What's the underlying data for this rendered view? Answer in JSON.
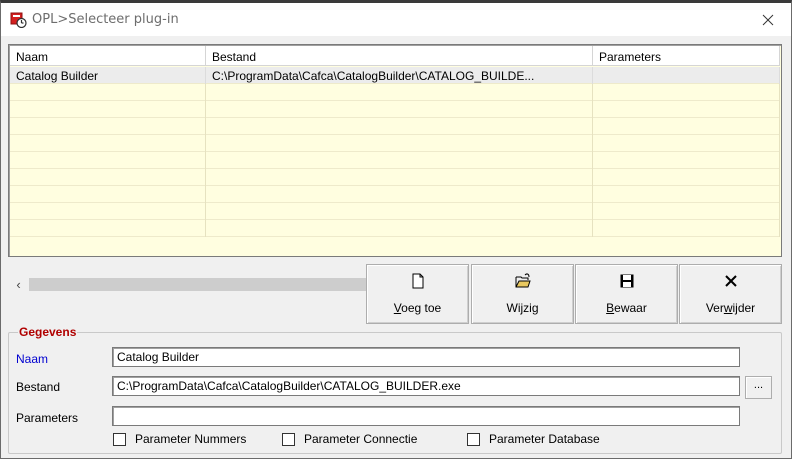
{
  "window": {
    "title": "OPL>Selecteer plug-in",
    "close_icon": "close-icon",
    "app_icon": "app-icon"
  },
  "list": {
    "columns": [
      "Naam",
      "Bestand",
      "Parameters"
    ],
    "rows": [
      {
        "naam": "Catalog Builder",
        "bestand": "C:\\ProgramData\\Cafca\\CatalogBuilder\\CATALOG_BUILDE...",
        "parameters": ""
      }
    ],
    "scroll_left": "‹",
    "scroll_right": "›"
  },
  "buttons": {
    "voeg_toe": {
      "hot": "V",
      "rest": "oeg toe",
      "icon": "new-document-icon"
    },
    "wijzig": {
      "hot": "",
      "rest": "Wijzig",
      "icon": "open-folder-icon"
    },
    "bewaar": {
      "hot": "B",
      "rest": "ewaar",
      "icon": "save-disk-icon"
    },
    "verwijder": {
      "pre": "Ver",
      "hot": "w",
      "rest": "ijder",
      "icon": "delete-x-icon"
    }
  },
  "gegevens": {
    "title": "Gegevens",
    "naam_label": "Naam",
    "naam_value": "Catalog Builder",
    "bestand_label": "Bestand",
    "bestand_value": "C:\\ProgramData\\Cafca\\CatalogBuilder\\CATALOG_BUILDER.exe",
    "browse_label": "...",
    "parameters_label": "Parameters",
    "parameters_value": "",
    "checkboxes": [
      {
        "label": "Parameter Nummers",
        "checked": false
      },
      {
        "label": "Parameter Connectie",
        "checked": false
      },
      {
        "label": "Parameter Database",
        "checked": false
      }
    ]
  },
  "colors": {
    "list_background": "#fffee0",
    "group_title": "#b00000",
    "naam_label": "#0000d0"
  }
}
